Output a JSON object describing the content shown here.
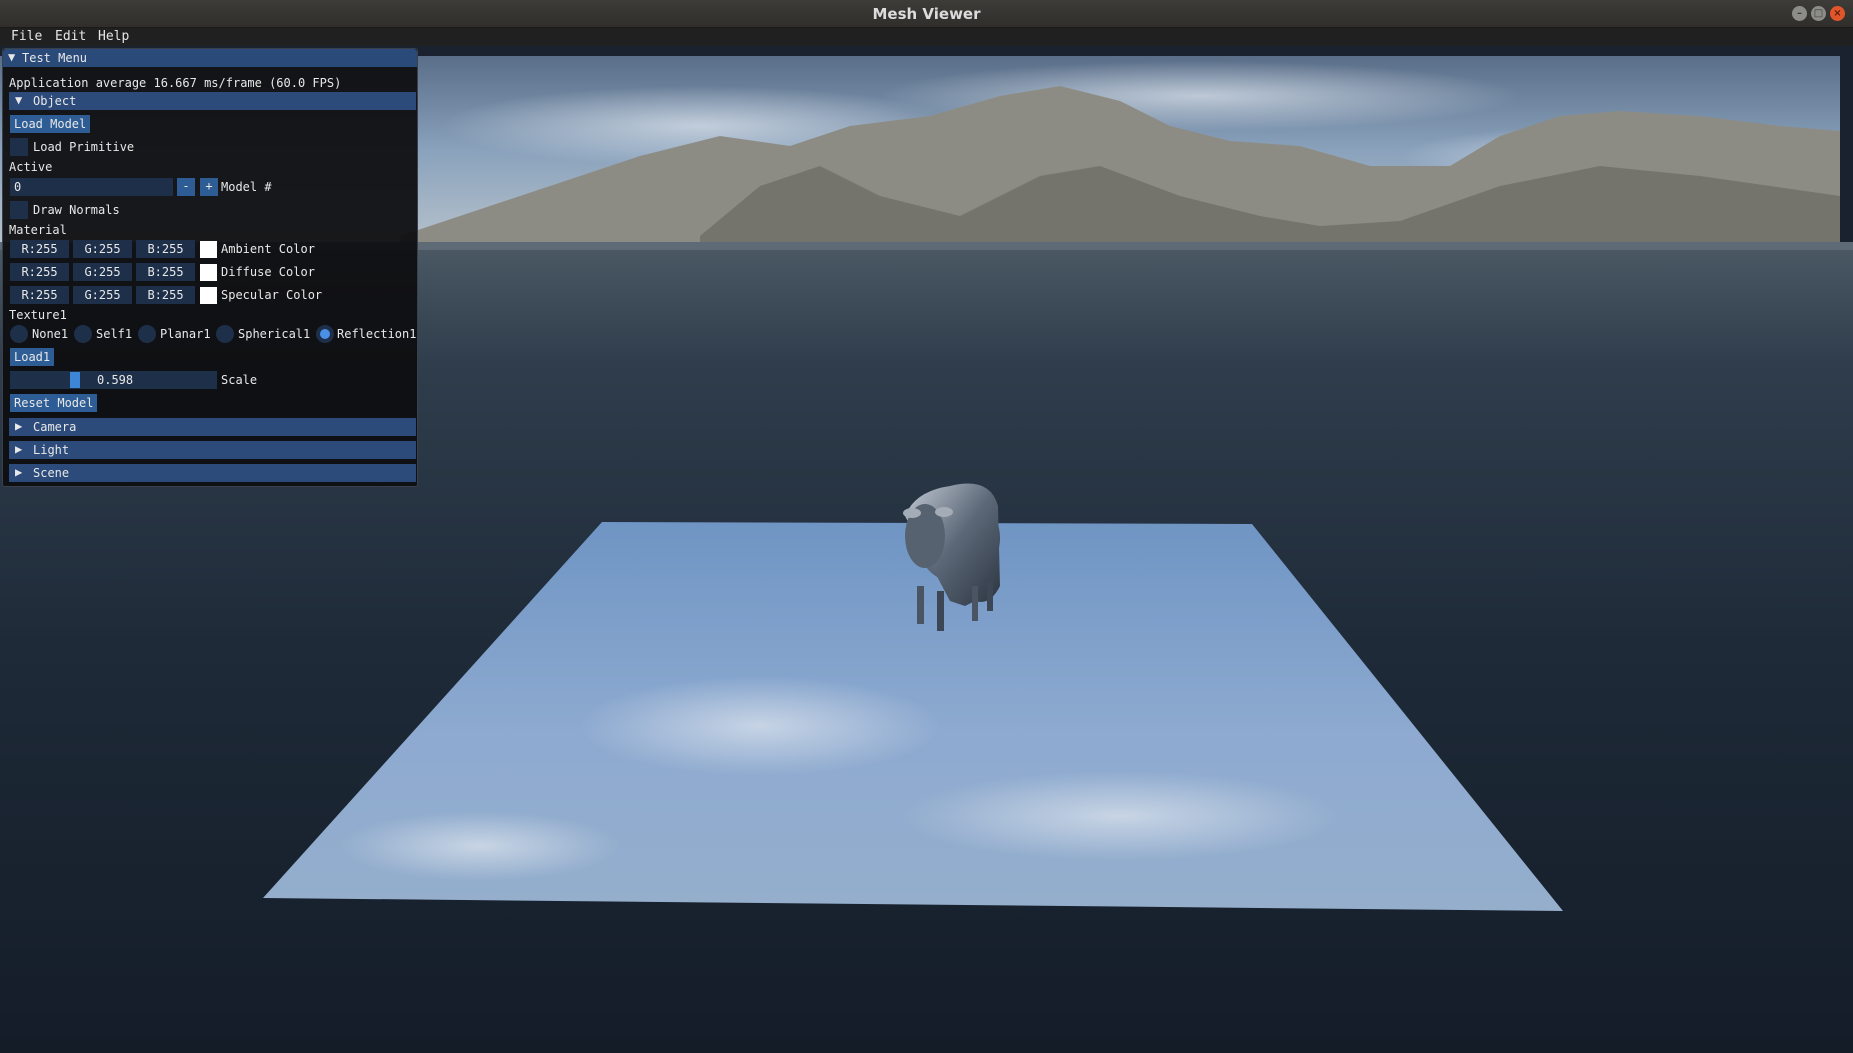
{
  "window": {
    "title": "Mesh Viewer",
    "buttons": [
      "minimize",
      "maximize",
      "close"
    ]
  },
  "menubar": [
    "File",
    "Edit",
    "Help"
  ],
  "panel": {
    "title": "Test Menu",
    "fps_text": "Application average 16.667 ms/frame (60.0 FPS)",
    "object": {
      "header": "Object",
      "load_model": "Load Model",
      "load_primitive": "Load Primitive",
      "active_label": "Active",
      "model_value": "0",
      "minus": "-",
      "plus": "+",
      "model_label": "Model #",
      "draw_normals": "Draw Normals",
      "material_label": "Material",
      "ambient": {
        "r": "R:255",
        "g": "G:255",
        "b": "B:255",
        "label": "Ambient Color"
      },
      "diffuse": {
        "r": "R:255",
        "g": "G:255",
        "b": "B:255",
        "label": "Diffuse Color"
      },
      "specular": {
        "r": "R:255",
        "g": "G:255",
        "b": "B:255",
        "label": "Specular Color"
      },
      "texture_label": "Texture1",
      "radios": [
        "None1",
        "Self1",
        "Planar1",
        "Spherical1",
        "Reflection1"
      ],
      "selected_radio": "Reflection1",
      "load1": "Load1",
      "scale_value": "0.598",
      "scale_label": "Scale",
      "reset_model": "Reset Model"
    },
    "collapsed_headers": [
      "Camera",
      "Light",
      "Scene"
    ]
  },
  "colors": {
    "accent": "#2d5d94",
    "header": "#2c4b7b",
    "radio_selected": "#4a90e6",
    "close_button": "#e0562a"
  }
}
